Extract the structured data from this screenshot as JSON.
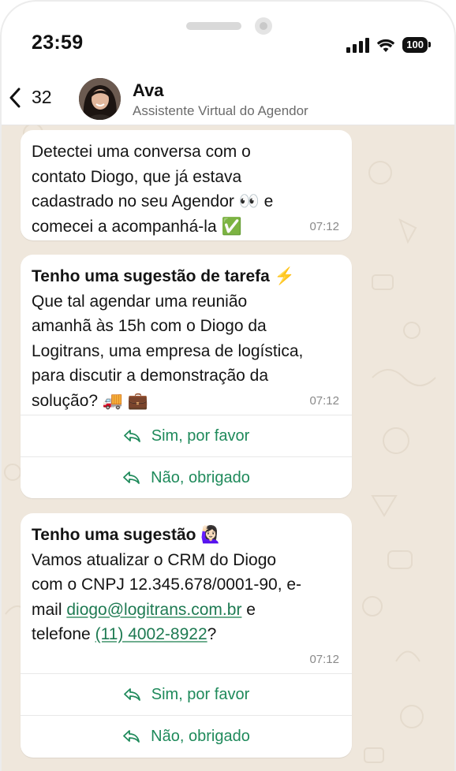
{
  "status_bar": {
    "time": "23:59",
    "battery": "100"
  },
  "header": {
    "unread_count": "32",
    "contact_name": "Ava",
    "contact_subtitle": "Assistente Virtual do Agendor"
  },
  "messages": [
    {
      "text_parts": {
        "line1": "Detectei uma conversa com o",
        "line2": "contato Diogo, que já estava",
        "line3": "cadastrado no seu Agendor 👀 e",
        "line4": "comecei a acompanhá-la ✅"
      },
      "time": "07:12"
    },
    {
      "title": "Tenho uma sugestão de tarefa ⚡",
      "body": {
        "line1": "Que tal agendar uma reunião",
        "line2": "amanhã às 15h com o Diogo da",
        "line3": "Logitrans, uma empresa de logística,",
        "line4": "para discutir a demonstração da",
        "line5": "solução? 🚚 💼"
      },
      "time": "07:12",
      "buttons": [
        "Sim, por favor",
        "Não, obrigado"
      ]
    },
    {
      "title": "Tenho uma sugestão 🙋🏻‍♀️",
      "body": {
        "line1": "Vamos atualizar o CRM do Diogo",
        "line2": "com o CNPJ 12.345.678/0001-90, e-",
        "line3_prefix": "mail ",
        "email": "diogo@logitrans.com.br",
        "line3_suffix": " e",
        "line4_prefix": "telefone ",
        "phone": "(11) 4002-8922",
        "line4_suffix": "?"
      },
      "time": "07:12",
      "buttons": [
        "Sim, por favor",
        "Não, obrigado"
      ]
    }
  ],
  "colors": {
    "chat_background": "#efe7dc",
    "accent_green": "#1f8a5b",
    "link_green": "#1e7a52"
  },
  "icons": [
    "back-chevron-icon",
    "signal-icon",
    "wifi-icon",
    "battery-icon",
    "reply-icon"
  ]
}
